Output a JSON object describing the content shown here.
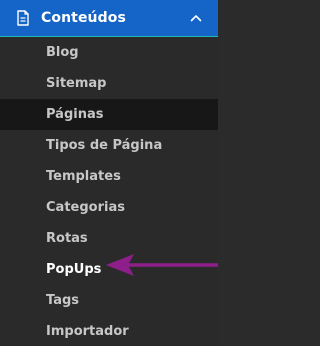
{
  "header": {
    "title": "Conteúdos",
    "icon": "document-icon",
    "chevron": "chevron-up-icon",
    "background_color": "#1565c8",
    "divider_color": "#1fb8b0"
  },
  "items": [
    {
      "label": "Blog"
    },
    {
      "label": "Sitemap"
    },
    {
      "label": "Páginas"
    },
    {
      "label": "Tipos de Página"
    },
    {
      "label": "Templates"
    },
    {
      "label": "Categorias"
    },
    {
      "label": "Rotas"
    },
    {
      "label": "PopUps"
    },
    {
      "label": "Tags"
    },
    {
      "label": "Importador"
    }
  ],
  "annotation": {
    "type": "arrow",
    "points_to": "PopUps",
    "color": "#8e1f8a"
  }
}
